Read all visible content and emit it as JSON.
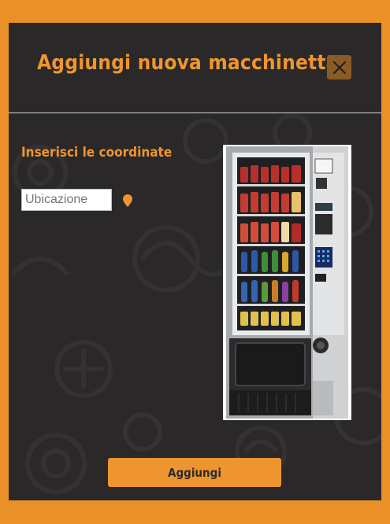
{
  "modal": {
    "title": "Aggiungi nuova macchinetta",
    "close_icon": "close-icon",
    "subtitle": "Inserisci le coordinate",
    "location_placeholder": "Ubicazione",
    "location_value": "",
    "location_icon": "map-pin-icon",
    "image": "vending-machine-image",
    "submit_label": "Aggiungi"
  },
  "colors": {
    "page_background": "#e99128",
    "modal_background": "#2a2829",
    "accent": "#ee9530",
    "close_button": "#8a5b25"
  }
}
